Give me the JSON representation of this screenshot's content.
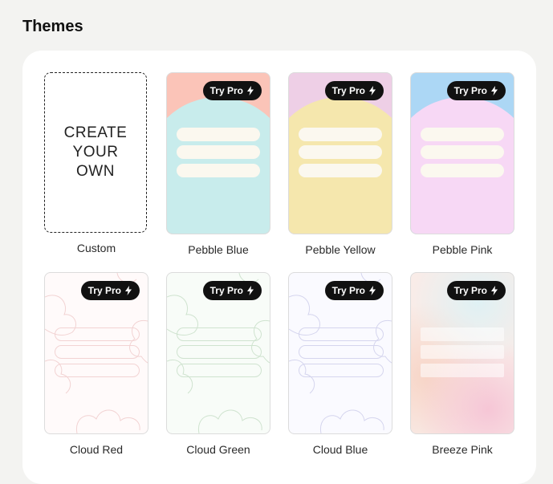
{
  "section": {
    "title": "Themes"
  },
  "badge": {
    "label": "Try Pro",
    "icon": "lightning-icon"
  },
  "themes": [
    {
      "label": "Custom",
      "custom_text": "CREATE\nYOUR\nOWN"
    },
    {
      "label": "Pebble Blue",
      "pro": true,
      "top_color": "#fbc4b8",
      "blob_color": "#c8ecec"
    },
    {
      "label": "Pebble Yellow",
      "pro": true,
      "top_color": "#eecfe6",
      "blob_color": "#f5e7ad"
    },
    {
      "label": "Pebble Pink",
      "pro": true,
      "top_color": "#acd7f5",
      "blob_color": "#f7d8f5"
    },
    {
      "label": "Cloud Red",
      "pro": true,
      "bg_color": "#fffafa",
      "line_color": "#f2d3d3"
    },
    {
      "label": "Cloud Green",
      "pro": true,
      "bg_color": "#f8fcf8",
      "line_color": "#cfe3cf"
    },
    {
      "label": "Cloud Blue",
      "pro": true,
      "bg_color": "#fafaff",
      "line_color": "#d5d5ee"
    },
    {
      "label": "Breeze Pink",
      "pro": true,
      "colors": [
        "#e3f1f4",
        "#f8d6de",
        "#f6d1c4"
      ]
    }
  ]
}
